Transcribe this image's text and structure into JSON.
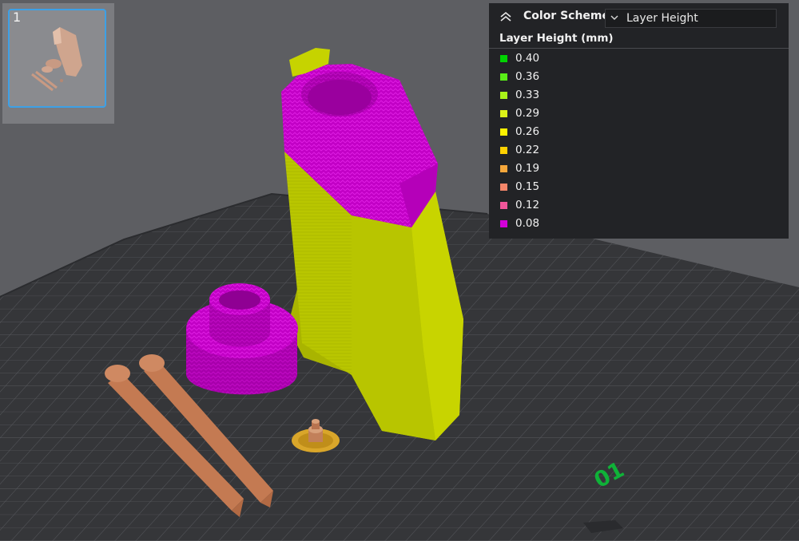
{
  "thumbnail": {
    "plate_number": "1"
  },
  "color_scheme": {
    "title": "Color Scheme",
    "selected": "Layer Height",
    "subtitle": "Layer Height (mm)",
    "items": [
      {
        "label": "0.40",
        "color": "#00d400"
      },
      {
        "label": "0.36",
        "color": "#59ee17"
      },
      {
        "label": "0.33",
        "color": "#a9f319"
      },
      {
        "label": "0.29",
        "color": "#dcf218"
      },
      {
        "label": "0.26",
        "color": "#fff200"
      },
      {
        "label": "0.22",
        "color": "#ffd100"
      },
      {
        "label": "0.19",
        "color": "#f5a73b"
      },
      {
        "label": "0.15",
        "color": "#f5866a"
      },
      {
        "label": "0.12",
        "color": "#f0569a"
      },
      {
        "label": "0.08",
        "color": "#d300d8"
      }
    ]
  },
  "plate": {
    "label": "01"
  }
}
